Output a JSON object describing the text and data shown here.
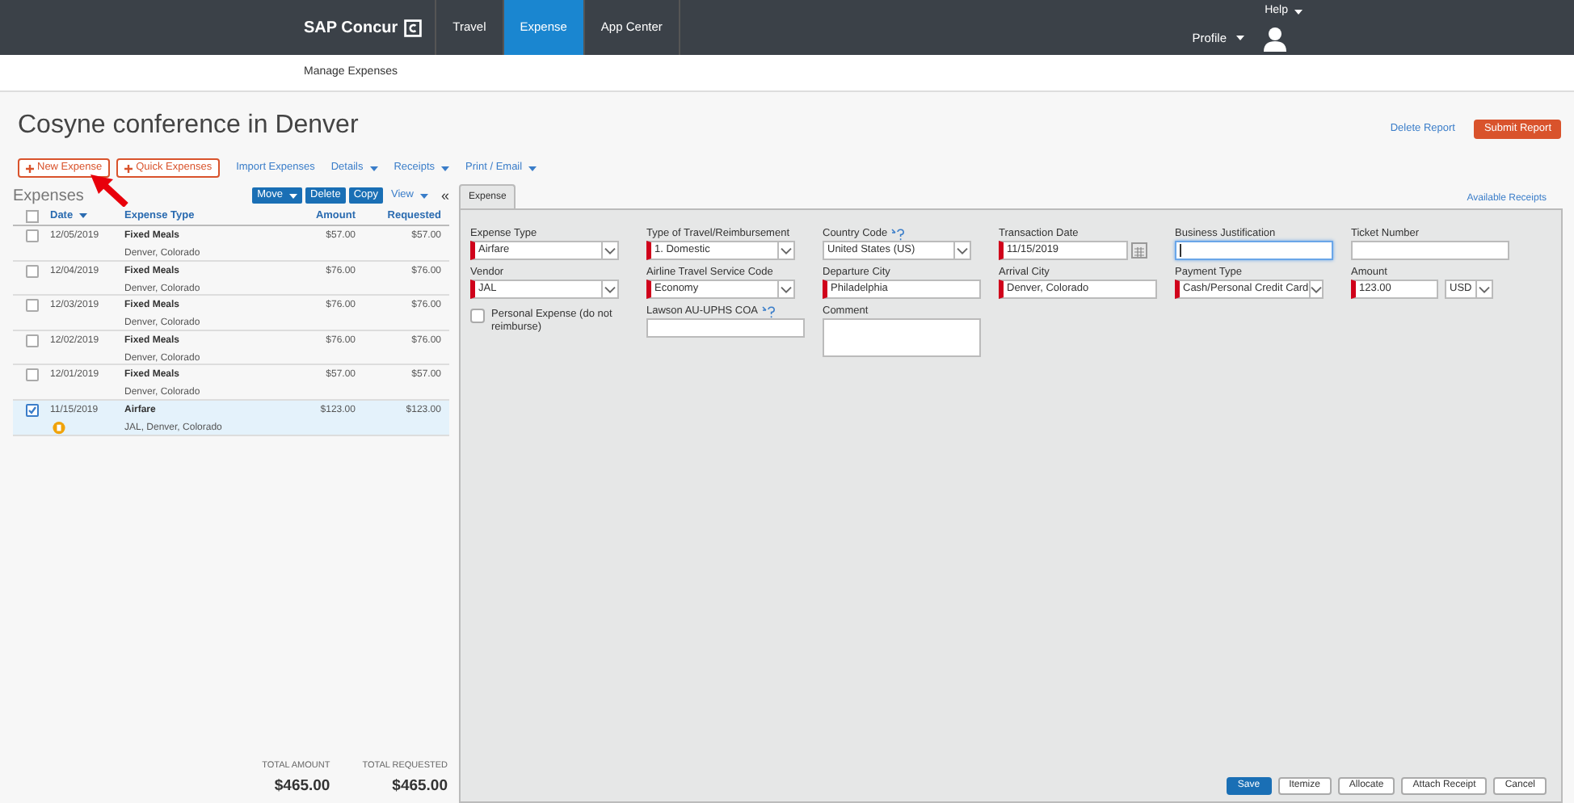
{
  "brand": "SAP Concur",
  "nav": [
    {
      "label": "Travel",
      "selected": false
    },
    {
      "label": "Expense",
      "selected": true
    },
    {
      "label": "App Center",
      "selected": false
    }
  ],
  "help": "Help",
  "profile": "Profile",
  "subnav": [
    {
      "label": "Manage Expenses",
      "selected": true
    }
  ],
  "report": {
    "title": "Cosyne conference in Denver",
    "delete": "Delete Report",
    "submit": "Submit Report"
  },
  "toolbar": [
    {
      "label": "New Expense",
      "kind": "add"
    },
    {
      "label": "Quick Expenses",
      "kind": "add"
    },
    {
      "label": "Import Expenses",
      "kind": "link"
    },
    {
      "label": "Details",
      "kind": "menu"
    },
    {
      "label": "Receipts",
      "kind": "menu"
    },
    {
      "label": "Print / Email",
      "kind": "menu"
    }
  ],
  "expenses": {
    "title": "Expenses",
    "actions": [
      {
        "label": "Move",
        "kind": "menu"
      },
      {
        "label": "Delete",
        "kind": "button"
      },
      {
        "label": "Copy",
        "kind": "button"
      },
      {
        "label": "View",
        "kind": "link"
      }
    ],
    "collapse": "«",
    "columns": [
      "Date",
      "Expense Type",
      "Amount",
      "Requested"
    ],
    "all_checked": false,
    "rows": [
      {
        "date": "12/05/2019",
        "type": "Fixed Meals",
        "location": "Denver, Colorado",
        "amount": "$57.00",
        "requested": "$57.00",
        "checked": false,
        "receipt": false
      },
      {
        "date": "12/04/2019",
        "type": "Fixed Meals",
        "location": "Denver, Colorado",
        "amount": "$76.00",
        "requested": "$76.00",
        "checked": false,
        "receipt": false
      },
      {
        "date": "12/03/2019",
        "type": "Fixed Meals",
        "location": "Denver, Colorado",
        "amount": "$76.00",
        "requested": "$76.00",
        "checked": false,
        "receipt": false
      },
      {
        "date": "12/02/2019",
        "type": "Fixed Meals",
        "location": "Denver, Colorado",
        "amount": "$76.00",
        "requested": "$76.00",
        "checked": false,
        "receipt": false
      },
      {
        "date": "12/01/2019",
        "type": "Fixed Meals",
        "location": "Denver, Colorado",
        "amount": "$57.00",
        "requested": "$57.00",
        "checked": false,
        "receipt": false
      },
      {
        "date": "11/15/2019",
        "type": "Airfare",
        "location": "JAL, Denver, Colorado",
        "amount": "$123.00",
        "requested": "$123.00",
        "checked": true,
        "receipt": true
      }
    ],
    "totals": [
      {
        "label": "TOTAL AMOUNT",
        "value": "$465.00"
      },
      {
        "label": "TOTAL REQUESTED",
        "value": "$465.00"
      }
    ]
  },
  "detail": {
    "tabs": [
      {
        "label": "Expense",
        "selected": true
      }
    ],
    "available_receipts": "Available Receipts",
    "rows": [
      [
        {
          "kind": "select",
          "label": "Expense Type",
          "value": "Airfare",
          "required": true,
          "help": false,
          "focused": false
        },
        {
          "kind": "select",
          "label": "Type of Travel/Reimbursement",
          "value": "1. Domestic",
          "required": true,
          "help": false,
          "focused": false
        },
        {
          "kind": "select",
          "label": "Country Code",
          "value": "United States (US)",
          "required": false,
          "help": true,
          "focused": false
        },
        {
          "kind": "date",
          "label": "Transaction Date",
          "value": "11/15/2019",
          "required": true,
          "help": false,
          "focused": false
        },
        {
          "kind": "text",
          "label": "Business Justification",
          "required": false,
          "help": false,
          "focused": true
        },
        {
          "kind": "text",
          "label": "Ticket Number",
          "required": false,
          "help": false,
          "focused": false
        }
      ],
      [
        {
          "kind": "select",
          "label": "Vendor",
          "value": "JAL",
          "required": true,
          "help": false,
          "focused": false
        },
        {
          "kind": "select",
          "label": "Airline Travel Service Code",
          "value": "Economy",
          "required": true,
          "help": false,
          "focused": false
        },
        {
          "kind": "text",
          "label": "Departure City",
          "value": "Philadelphia",
          "required": true,
          "help": false,
          "focused": false
        },
        {
          "kind": "text",
          "label": "Arrival City",
          "value": "Denver, Colorado",
          "required": true,
          "help": false,
          "focused": false
        },
        {
          "kind": "select",
          "label": "Payment Type",
          "value": "Cash/Personal Credit Card",
          "required": true,
          "help": false,
          "focused": false
        },
        {
          "kind": "amount",
          "label": "Amount",
          "value": "123.00",
          "currency": "USD",
          "required": true,
          "help": false,
          "focused": false
        }
      ],
      [
        {
          "kind": "checkbox",
          "label": "Personal Expense (do not reimburse)",
          "checked": false
        },
        {
          "kind": "text",
          "label": "Lawson AU-UPHS COA",
          "required": false,
          "help": true,
          "focused": false
        },
        {
          "kind": "textarea",
          "label": "Comment",
          "required": false,
          "help": false,
          "focused": false
        }
      ]
    ],
    "buttons": [
      {
        "label": "Save",
        "kind": "primary"
      },
      {
        "label": "Itemize",
        "kind": "secondary"
      },
      {
        "label": "Allocate",
        "kind": "secondary"
      },
      {
        "label": "Attach Receipt",
        "kind": "secondary"
      },
      {
        "label": "Cancel",
        "kind": "secondary"
      }
    ]
  }
}
